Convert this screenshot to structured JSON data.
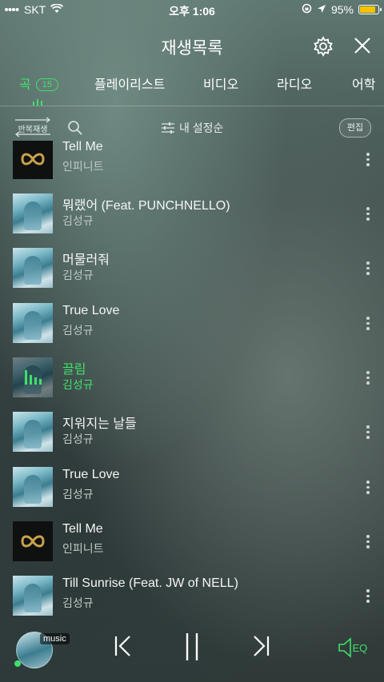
{
  "status": {
    "carrier": "SKT",
    "time": "오후 1:06",
    "battery": "95%",
    "battery_level": 0.95
  },
  "header": {
    "title": "재생목록"
  },
  "tabs": [
    {
      "label": "곡",
      "badge": "15",
      "active": true
    },
    {
      "label": "플레이리스트"
    },
    {
      "label": "비디오"
    },
    {
      "label": "라디오"
    },
    {
      "label": "어학"
    }
  ],
  "toolbar": {
    "repeat_label": "반복재생",
    "sort_label": "내 설정순",
    "edit_label": "편집"
  },
  "songs": [
    {
      "title": "Tell Me",
      "artist": "인피니트",
      "art": "infinite-logo"
    },
    {
      "title": "뭐랬어 (Feat. PUNCHNELLO)",
      "artist": "김성규",
      "art": "cover"
    },
    {
      "title": "머물러줘",
      "artist": "김성규",
      "art": "cover"
    },
    {
      "title": "True Love",
      "artist": "김성규",
      "art": "cover"
    },
    {
      "title": "끌림",
      "artist": "김성규",
      "art": "playing",
      "now_playing": true
    },
    {
      "title": "지워지는 날들",
      "artist": "김성규",
      "art": "cover"
    },
    {
      "title": "True Love",
      "artist": "김성규",
      "art": "cover"
    },
    {
      "title": "Tell Me",
      "artist": "인피니트",
      "art": "infinite-logo"
    },
    {
      "title": "Till Sunrise (Feat. JW of NELL)",
      "artist": "김성규",
      "art": "cover"
    }
  ],
  "player": {
    "source_label": "music",
    "eq_label": "EQ"
  },
  "colors": {
    "accent": "#3ee16a",
    "battery": "#f4c400",
    "infinite_gold": "#c9a24a"
  }
}
